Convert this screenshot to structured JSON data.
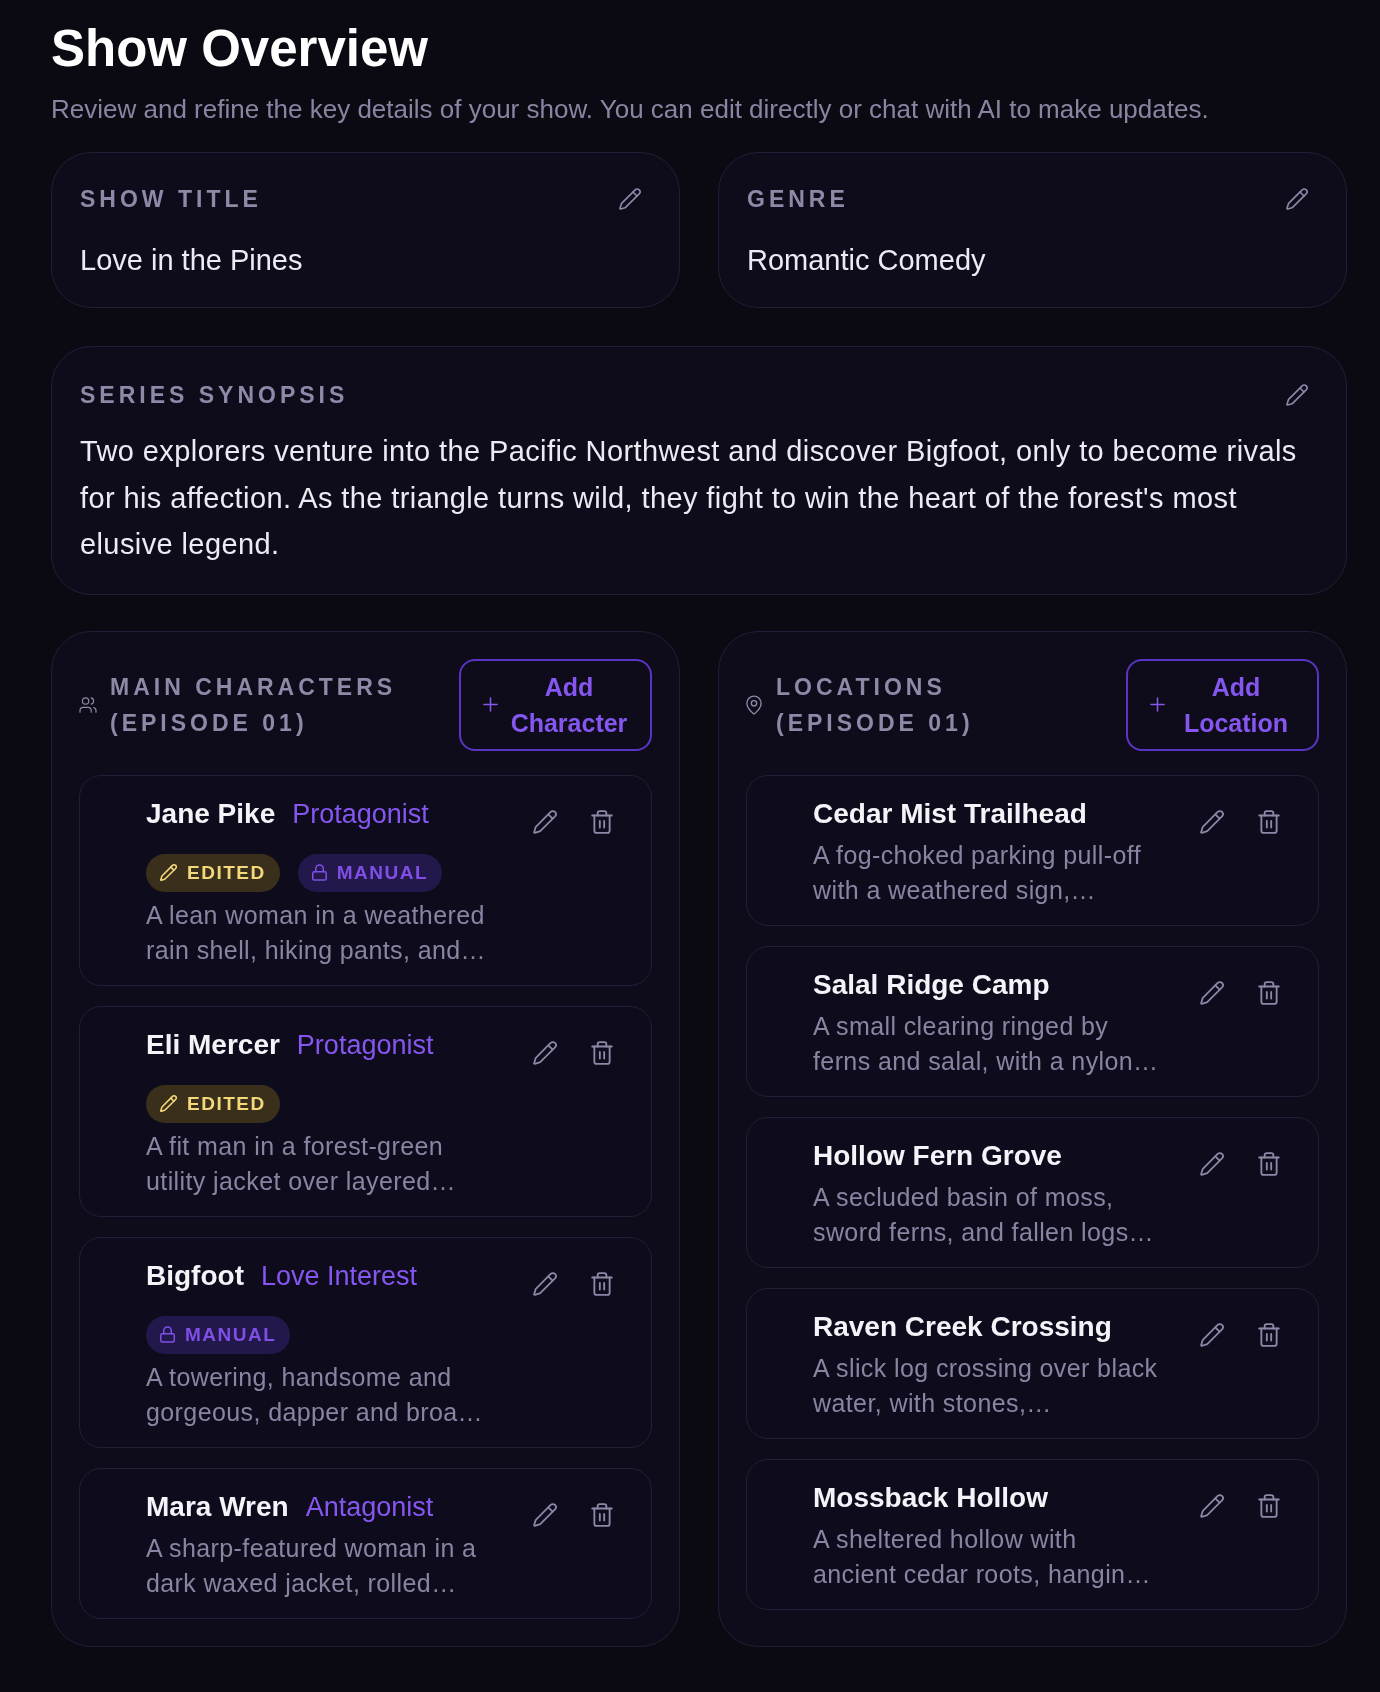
{
  "page": {
    "title": "Show Overview",
    "subtitle": "Review and refine the key details of your show. You can edit directly or chat with AI to make updates."
  },
  "fields": [
    {
      "label": "SHOW TITLE",
      "value": "Love in the Pines"
    },
    {
      "label": "GENRE",
      "value": "Romantic Comedy"
    }
  ],
  "synopsis": {
    "label": "SERIES SYNOPSIS",
    "text": "Two explorers venture into the Pacific Northwest and discover Bigfoot, only to become rivals for his affection. As the triangle turns wild, they fight to win the heart of the forest's most elusive legend."
  },
  "panels": [
    {
      "kind": "characters",
      "title": "MAIN CHARACTERS (EPISODE 01)",
      "add_button": "Add Character",
      "items": [
        {
          "name": "Jane Pike",
          "role": "Protagonist",
          "badges": [
            {
              "kind": "edited",
              "label": "EDITED"
            },
            {
              "kind": "manual",
              "label": "MANUAL"
            }
          ],
          "description": "A lean woman in a weathered rain shell, hiking pants, and…"
        },
        {
          "name": "Eli Mercer",
          "role": "Protagonist",
          "badges": [
            {
              "kind": "edited",
              "label": "EDITED"
            }
          ],
          "description": "A fit man in a forest-green utility jacket over layered…"
        },
        {
          "name": "Bigfoot",
          "role": "Love Interest",
          "badges": [
            {
              "kind": "manual",
              "label": "MANUAL"
            }
          ],
          "description": "A towering, handsome and gorgeous, dapper and broa…"
        },
        {
          "name": "Mara Wren",
          "role": "Antagonist",
          "description": "A sharp-featured woman in a dark waxed jacket, rolled…"
        }
      ]
    },
    {
      "kind": "locations",
      "title": "LOCATIONS (EPISODE 01)",
      "add_button": "Add Location",
      "items": [
        {
          "name": "Cedar Mist Trailhead",
          "description": "A fog-choked parking pull-off with a weathered sign,…"
        },
        {
          "name": "Salal Ridge Camp",
          "description": "A small clearing ringed by ferns and salal, with a nylon…"
        },
        {
          "name": "Hollow Fern Grove",
          "description": "A secluded basin of moss, sword ferns, and fallen logs…"
        },
        {
          "name": "Raven Creek Crossing",
          "description": "A slick log crossing over black water, with stones,…"
        },
        {
          "name": "Mossback Hollow",
          "description": "A sheltered hollow with ancient cedar roots, hangin…"
        }
      ]
    }
  ]
}
